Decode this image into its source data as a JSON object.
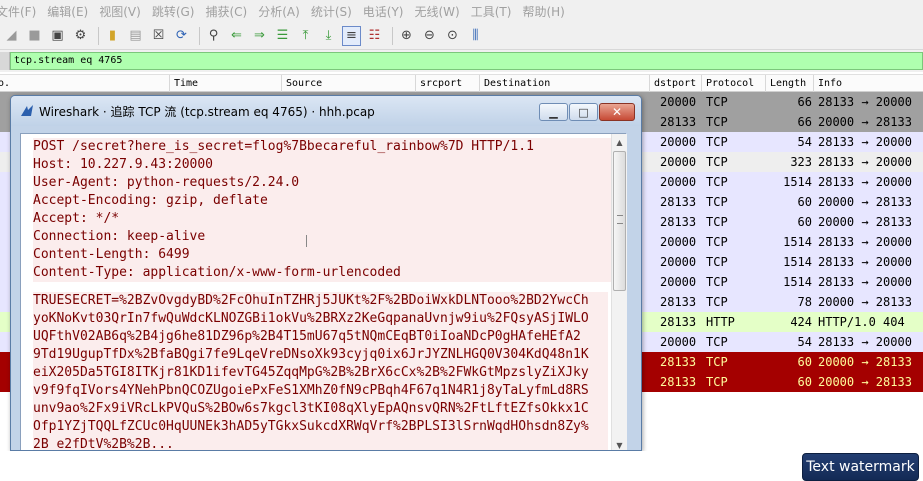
{
  "menubar": {
    "items": [
      "文件(F)",
      "编辑(E)",
      "视图(V)",
      "跳转(G)",
      "捕获(C)",
      "分析(A)",
      "统计(S)",
      "电话(Y)",
      "无线(W)",
      "工具(T)",
      "帮助(H)"
    ]
  },
  "filter": {
    "value": "tcp.stream eq 4765"
  },
  "packet_list": {
    "columns": {
      "no": "o.",
      "time": "Time",
      "source": "Source",
      "srcport": "srcport",
      "destination": "Destination",
      "dstport": "dstport",
      "protocol": "Protocol",
      "length": "Length",
      "info": "Info"
    },
    "rows": [
      {
        "dstport": "20000",
        "proto": "TCP",
        "len": "66",
        "info": "28133 → 20000",
        "bg": "#a0a0a0",
        "fg": "#000000"
      },
      {
        "dstport": "28133",
        "proto": "TCP",
        "len": "66",
        "info": "20000 → 28133",
        "bg": "#a0a0a0",
        "fg": "#000000"
      },
      {
        "dstport": "20000",
        "proto": "TCP",
        "len": "54",
        "info": "28133 → 20000",
        "bg": "#e7e6ff",
        "fg": "#000000"
      },
      {
        "dstport": "20000",
        "proto": "TCP",
        "len": "323",
        "info": "28133 → 20000",
        "bg": "#eeeeee",
        "fg": "#000000"
      },
      {
        "dstport": "20000",
        "proto": "TCP",
        "len": "1514",
        "info": "28133 → 20000",
        "bg": "#e7e6ff",
        "fg": "#000000"
      },
      {
        "dstport": "28133",
        "proto": "TCP",
        "len": "60",
        "info": "20000 → 28133",
        "bg": "#e7e6ff",
        "fg": "#000000"
      },
      {
        "dstport": "28133",
        "proto": "TCP",
        "len": "60",
        "info": "20000 → 28133",
        "bg": "#e7e6ff",
        "fg": "#000000"
      },
      {
        "dstport": "20000",
        "proto": "TCP",
        "len": "1514",
        "info": "28133 → 20000",
        "bg": "#e7e6ff",
        "fg": "#000000"
      },
      {
        "dstport": "20000",
        "proto": "TCP",
        "len": "1514",
        "info": "28133 → 20000",
        "bg": "#e7e6ff",
        "fg": "#000000"
      },
      {
        "dstport": "20000",
        "proto": "TCP",
        "len": "1514",
        "info": "28133 → 20000",
        "bg": "#e7e6ff",
        "fg": "#000000"
      },
      {
        "dstport": "28133",
        "proto": "TCP",
        "len": "78",
        "info": "20000 → 28133",
        "bg": "#e7e6ff",
        "fg": "#000000"
      },
      {
        "dstport": "28133",
        "proto": "HTTP",
        "len": "424",
        "info": "HTTP/1.0 404",
        "bg": "#e4ffc7",
        "fg": "#000000"
      },
      {
        "dstport": "20000",
        "proto": "TCP",
        "len": "54",
        "info": "28133 → 20000",
        "bg": "#e7e6ff",
        "fg": "#000000"
      },
      {
        "dstport": "28133",
        "proto": "TCP",
        "len": "60",
        "info": "20000 → 28133",
        "bg": "#a40000",
        "fg": "#fffc9c"
      },
      {
        "dstport": "28133",
        "proto": "TCP",
        "len": "60",
        "info": "20000 → 28133",
        "bg": "#a40000",
        "fg": "#fffc9c"
      }
    ]
  },
  "dialog": {
    "title": "Wireshark · 追踪 TCP 流 (tcp.stream eq 4765) · hhh.pcap",
    "request_lines": [
      "POST /secret?here_is_secret=flog%7Bbecareful_rainbow%7D HTTP/1.1",
      "Host: 10.227.9.43:20000",
      "User-Agent: python-requests/2.24.0",
      "Accept-Encoding: gzip, deflate",
      "Accept: */*",
      "Connection: keep-alive",
      "Content-Length: 6499",
      "Content-Type: application/x-www-form-urlencoded"
    ],
    "body_lines": [
      "TRUESECRET=%2BZvOvgdyBD%2FcOhuInTZHRj5JUKt%2F%2BDoiWxkDLNTooo%2BD2YwcCh",
      "yoKNoKvt03QrIn7fwQuWdcKLNOZGBi1okVu%2BRXz2KeGqpanaUvnjw9iu%2FQsyASjIWLO",
      "UQFthV02AB6q%2B4jg6he81DZ96p%2B4T15mU67q5tNQmCEqBT0iIoaNDcP0gHAfeHEfA2",
      "9Td19UgupTfDx%2BfaBQgi7fe9LqeVreDNsoXk93cyjq0ix6JrJYZNLHGQ0V304KdQ48n1K",
      "eiX205Da5TGI8ITKjr81KD1ifevTG45ZqqMpG%2B%2BrX6cCx%2B%2FWkGtMpzslyZiXJky",
      "v9f9fqIVors4YNehPbnQCOZUgoiePxFeS1XMhZ0fN9cPBqh4F67q1N4R1j8yTaLyfmLd8RS",
      "unv9ao%2Fx9iVRcLkPVQuS%2BOw6s7kgcl3tKI08qXlyEpAQnsvQRN%2FtLftEZfsOkkx1C",
      "Ofp1YZjTQQLfZCUc0HqUUNEk3hAD5yTGkxSukcdXRWqVrf%2BPLSI3lSrnWqdHOhsdn8Zy%",
      "2B e2fDtV%2B%2B..."
    ]
  },
  "watermark": {
    "label": "Text watermark"
  },
  "icons": {
    "toolbar": [
      "shark-fin-icon",
      "stop-icon",
      "restart-icon",
      "options-gear-icon",
      "open-folder-icon",
      "save-file-icon",
      "close-file-icon",
      "reload-icon",
      "find-icon",
      "back-icon",
      "forward-icon",
      "go-to-packet-icon",
      "first-packet-icon",
      "last-packet-icon",
      "autoscroll-icon",
      "colorize-icon",
      "zoom-in-icon",
      "zoom-out-icon",
      "normal-size-icon",
      "resize-columns-icon"
    ]
  }
}
